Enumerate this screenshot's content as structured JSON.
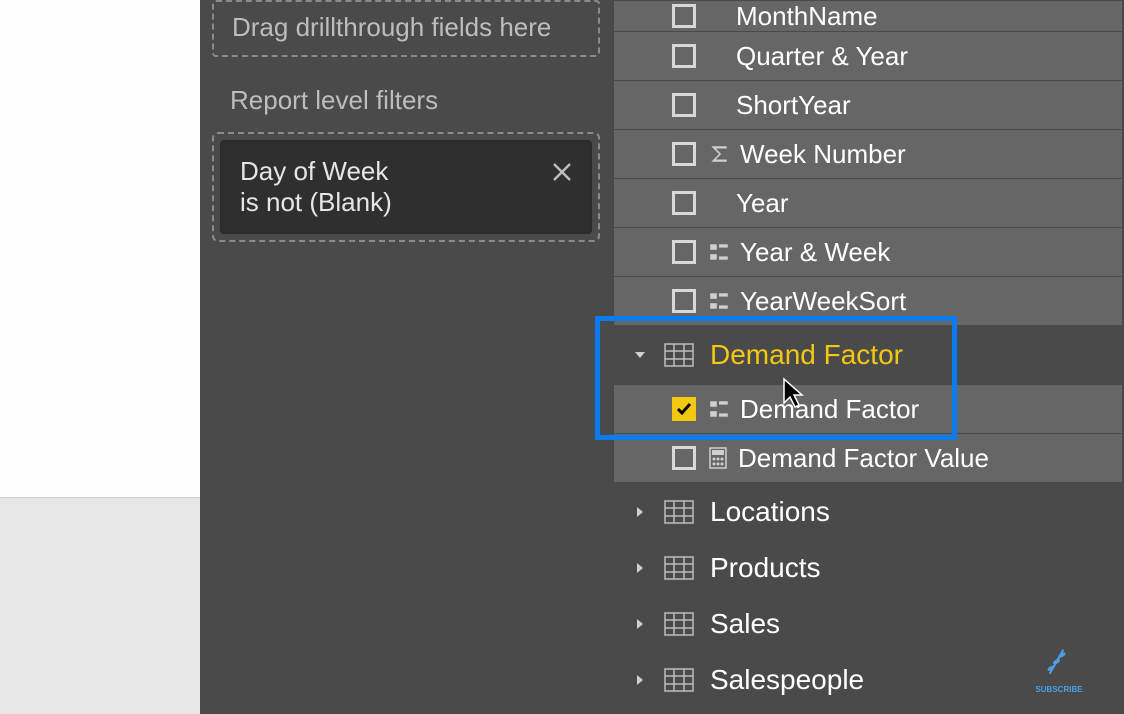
{
  "filters_pane": {
    "drillthrough_placeholder": "Drag drillthrough fields here",
    "report_level_label": "Report level filters",
    "filter": {
      "field": "Day of Week",
      "condition": "is not (Blank)"
    }
  },
  "fields": {
    "date_table_fields": [
      {
        "name": "MonthName",
        "icon": null
      },
      {
        "name": "Quarter & Year",
        "icon": null
      },
      {
        "name": "ShortYear",
        "icon": null
      },
      {
        "name": "Week Number",
        "icon": "sigma"
      },
      {
        "name": "Year",
        "icon": null
      },
      {
        "name": "Year & Week",
        "icon": "hier"
      },
      {
        "name": "YearWeekSort",
        "icon": "hier"
      }
    ],
    "demand_factor": {
      "table_name": "Demand Factor",
      "fields": [
        {
          "name": "Demand Factor",
          "icon": "hier",
          "checked": true
        },
        {
          "name": "Demand Factor Value",
          "icon": "calc",
          "checked": false
        }
      ]
    },
    "tables": [
      "Locations",
      "Products",
      "Sales",
      "Salespeople"
    ]
  }
}
